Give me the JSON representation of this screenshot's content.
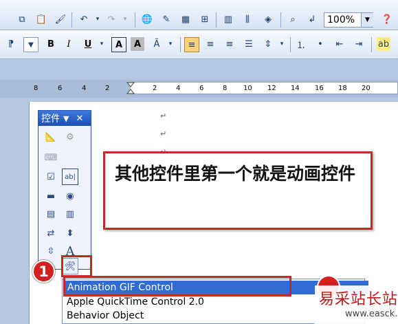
{
  "toolbar": {
    "zoom_value": "100%"
  },
  "ruler": {
    "ticks": [
      "8",
      "6",
      "4",
      "2",
      "2",
      "4",
      "6",
      "8",
      "10",
      "12",
      "14",
      "16",
      "18",
      "20"
    ]
  },
  "control_toolbox": {
    "title": "控件"
  },
  "callout": {
    "text": "其他控件里第一个就是动画控件"
  },
  "badges": {
    "step1": "1"
  },
  "control_list": {
    "items": [
      "Animation GIF Control",
      "Apple QuickTime Control 2.0",
      "Behavior Object"
    ],
    "selected_index": 0
  },
  "watermark": {
    "cn": "易采站长站",
    "url": "www.easck.com"
  },
  "colors": {
    "highlight_red": "#c62828",
    "selection_blue": "#2f6bd3"
  }
}
